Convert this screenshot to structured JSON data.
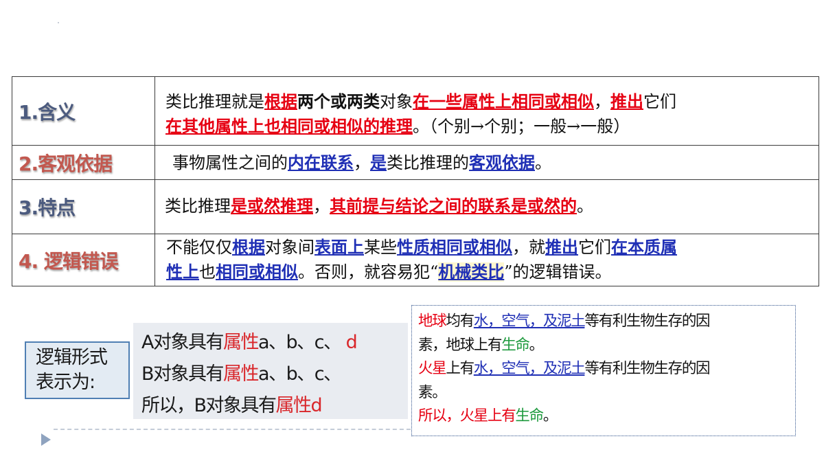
{
  "table": {
    "rows": [
      {
        "label": "1.含义",
        "line1": [
          {
            "t": "类比推理就是",
            "s": "n"
          },
          {
            "t": "根据",
            "s": "r"
          },
          {
            "t": "两个或两类",
            "s": "k"
          },
          {
            "t": "对象",
            "s": "n"
          },
          {
            "t": "在一些属性上相同或相似",
            "s": "r"
          },
          {
            "t": "，",
            "s": "n"
          },
          {
            "t": "推出",
            "s": "r"
          },
          {
            "t": "它们",
            "s": "n"
          }
        ],
        "line2": [
          {
            "t": "在其他属性上也相同或相似的推理",
            "s": "r"
          },
          {
            "t": "。（个别→个别；一般→一般）",
            "s": "n"
          }
        ]
      },
      {
        "label": "2.客观依据",
        "line1": [
          {
            "t": "事物属性之间的",
            "s": "n"
          },
          {
            "t": "内在联系",
            "s": "b"
          },
          {
            "t": "，",
            "s": "n"
          },
          {
            "t": "是",
            "s": "b"
          },
          {
            "t": "类比推理的",
            "s": "n"
          },
          {
            "t": "客观依据",
            "s": "b"
          },
          {
            "t": "。",
            "s": "n"
          }
        ]
      },
      {
        "label": "3.特点",
        "line1": [
          {
            "t": "类比推理",
            "s": "n"
          },
          {
            "t": "是或然推理",
            "s": "r"
          },
          {
            "t": "，",
            "s": "n"
          },
          {
            "t": "其前提与结论之间的联系是或然的",
            "s": "r"
          },
          {
            "t": "。",
            "s": "n"
          }
        ]
      },
      {
        "label": "4. 逻辑错误",
        "line1": [
          {
            "t": "不能仅仅",
            "s": "n"
          },
          {
            "t": "根据",
            "s": "b"
          },
          {
            "t": "对象间",
            "s": "n"
          },
          {
            "t": "表面上",
            "s": "b"
          },
          {
            "t": "某些",
            "s": "n"
          },
          {
            "t": "性质相同或相似",
            "s": "b"
          },
          {
            "t": "，就",
            "s": "n"
          },
          {
            "t": "推出",
            "s": "b"
          },
          {
            "t": "它们",
            "s": "n"
          },
          {
            "t": "在本质属",
            "s": "b"
          }
        ],
        "line2": [
          {
            "t": "性上",
            "s": "b"
          },
          {
            "t": "也",
            "s": "n"
          },
          {
            "t": "相同或相似",
            "s": "b"
          },
          {
            "t": "。否则，就容易犯“",
            "s": "n"
          },
          {
            "t": "机械类比",
            "s": "hl"
          },
          {
            "t": "”的逻辑错误。",
            "s": "n"
          }
        ]
      }
    ]
  },
  "logic_form": {
    "title_line1": "逻辑形式",
    "title_line2": "表示为:",
    "line1_a": "A对象具有",
    "line1_prop": "属性",
    "line1_b": "a、b、c、",
    "line1_d": "d",
    "line2_a": "B对象具有",
    "line2_prop": "属性",
    "line2_b": "a、b、c、",
    "line3_a": "所以，B对象具有",
    "line3_prop": "属性",
    "line3_d": "d"
  },
  "example": {
    "p1_earth": "地球",
    "p1_has": "均有",
    "p1_items": "水，空气，及泥土",
    "p1_rest": "等有利生物生存的因",
    "p1_line2a": "素，地球上有",
    "p1_life": "生命",
    "p1_end": "。",
    "p2_mars": "火星",
    "p2_has": "上有",
    "p2_items": "水，空气，及泥土",
    "p2_rest": "等有利生物生存的因",
    "p2_line2": "素。",
    "p3_so": "所以，火星上有",
    "p3_life": "生命",
    "p3_end": "。"
  },
  "colors": {
    "emphasis_red": "#e60012",
    "emphasis_blue": "#1f2fb5",
    "life_green": "#1e9a3e",
    "label_blue": "#4c5b7f",
    "label_red": "#c2584f"
  }
}
